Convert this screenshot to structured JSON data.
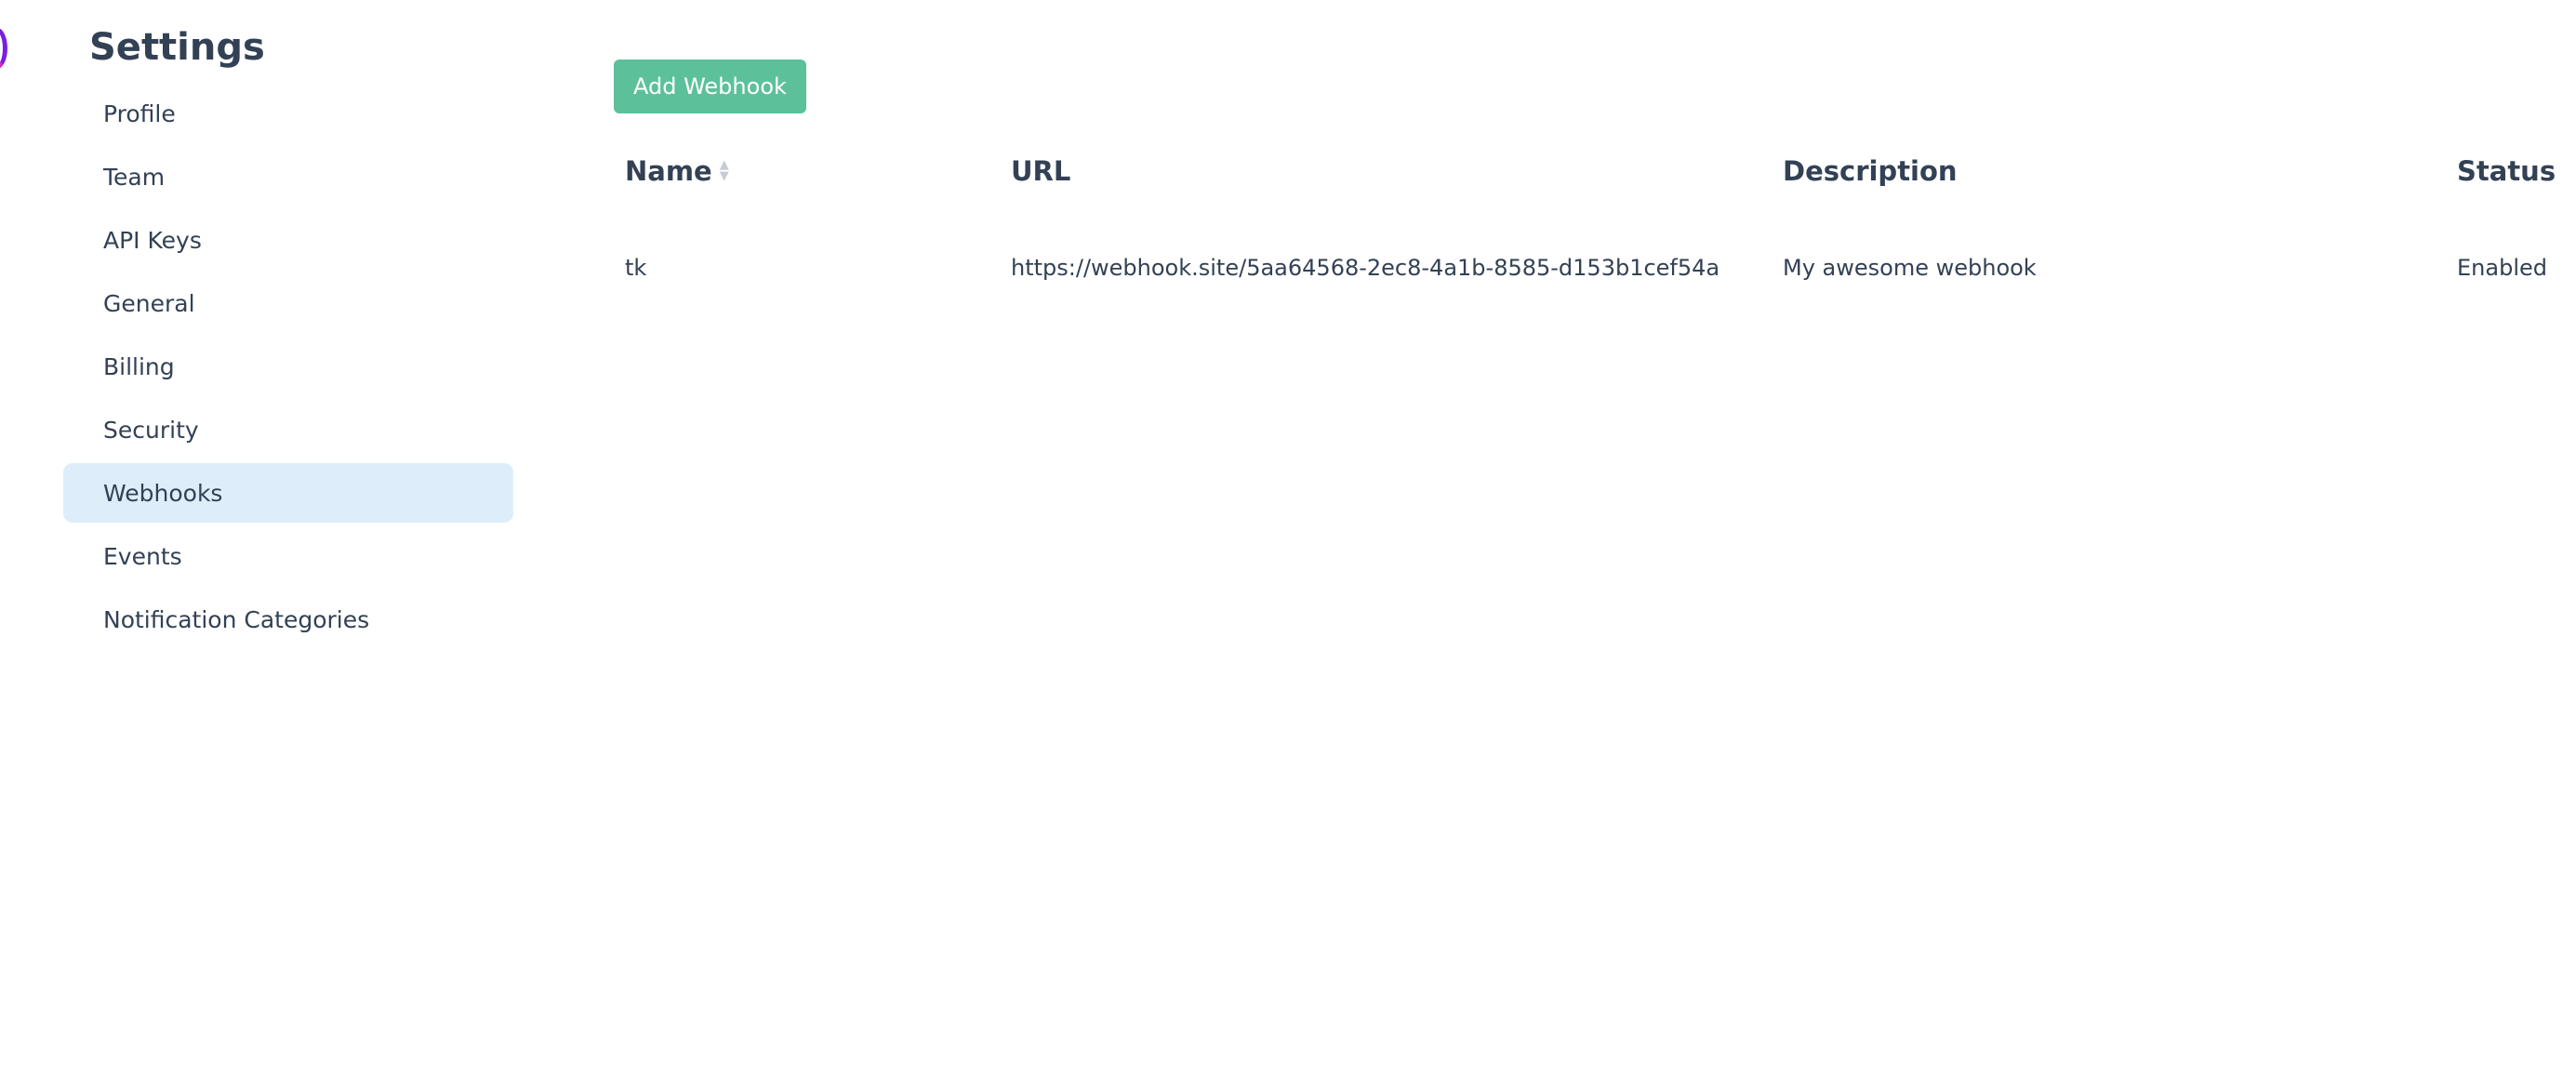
{
  "sidebar": {
    "title": "Settings",
    "items": [
      {
        "label": "Profile"
      },
      {
        "label": "Team"
      },
      {
        "label": "API Keys"
      },
      {
        "label": "General"
      },
      {
        "label": "Billing"
      },
      {
        "label": "Security"
      },
      {
        "label": "Webhooks",
        "active": true
      },
      {
        "label": "Events"
      },
      {
        "label": "Notification Categories"
      }
    ]
  },
  "toolbar": {
    "add_label": "Add Webhook"
  },
  "table": {
    "headers": {
      "name": "Name",
      "url": "URL",
      "description": "Description",
      "status": "Status"
    },
    "rows": [
      {
        "name": "tk",
        "url": "https://webhook.site/5aa64568-2ec8-4a1b-8585-d153b1cef54a",
        "description": "My awesome webhook",
        "status": "Enabled"
      }
    ]
  },
  "icons": {
    "sort": "sort-icon",
    "logo": "logo-fragment"
  },
  "colors": {
    "accent_button": "#5cc19a",
    "active_item_bg": "#ddeefa",
    "text": "#334155"
  }
}
